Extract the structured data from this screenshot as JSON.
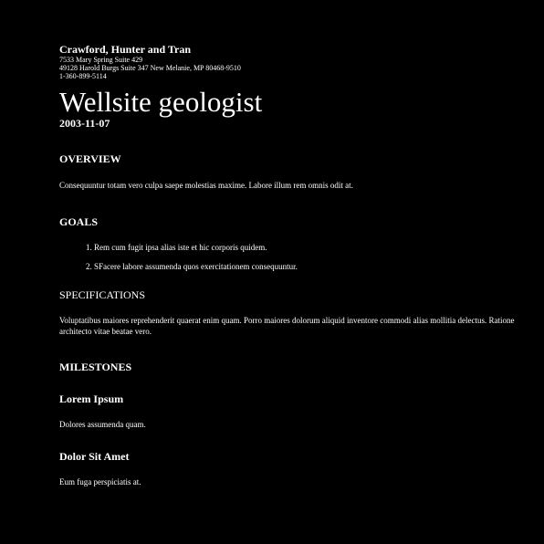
{
  "header": {
    "company": "Crawford, Hunter and Tran",
    "address_line1": "7533 Mary Spring Suite 429",
    "address_line2": "49128 Harold Burgs Suite 347 New Melanie, MP 80468-9510",
    "phone": "1-360-899-5114"
  },
  "document": {
    "title": "Wellsite geologist",
    "date": "2003-11-07"
  },
  "overview": {
    "heading": "OVERVIEW",
    "text": "Consequuntur totam vero culpa saepe molestias maxime. Labore illum rem omnis odit at."
  },
  "goals": {
    "heading": "GOALS",
    "items": [
      "Rem cum fugit ipsa alias iste et hic corporis quidem.",
      "SFacere labore assumenda quos exercitationem consequuntur."
    ]
  },
  "specifications": {
    "heading": "SPECIFICATIONS",
    "text": "Voluptatibus maiores reprehenderit quaerat enim quam. Porro maiores dolorum aliquid inventore commodi alias mollitia delectus. Ratione architecto vitae beatae vero."
  },
  "milestones": {
    "heading": "MILESTONES",
    "items": [
      {
        "title": "Lorem Ipsum",
        "text": "Dolores assumenda quam."
      },
      {
        "title": "Dolor Sit Amet",
        "text": "Eum fuga perspiciatis at."
      }
    ]
  }
}
